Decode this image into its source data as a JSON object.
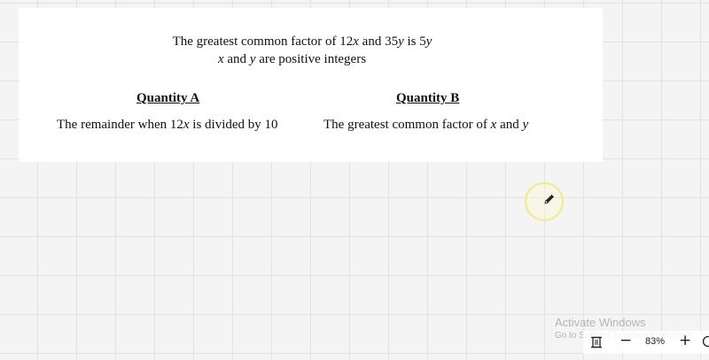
{
  "problem": {
    "statement_line1": {
      "p1": "The greatest common factor of 12",
      "v1": "x",
      "p2": " and 35",
      "v2": "y",
      "p3": " is 5",
      "v3": "y"
    },
    "statement_line2": {
      "v1": "x",
      "p1": " and ",
      "v2": "y",
      "p2": " are positive integers"
    },
    "quantity_a": {
      "heading": "Quantity A",
      "p1": "The remainder when 12",
      "v1": "x",
      "p2": " is divided by 10"
    },
    "quantity_b": {
      "heading": "Quantity B",
      "p1": "The greatest common factor of ",
      "v1": "x",
      "p2": " and ",
      "v2": "y"
    }
  },
  "watermark": {
    "line1": "Activate Windows",
    "line2": "Go to Settings to activate Windows."
  },
  "toolbar": {
    "fit_icon": "fit-page-icon",
    "zoom_out_label": "−",
    "zoom_level": "83%",
    "zoom_in_label": "+",
    "more_icon": "more-icon"
  },
  "cursor": {
    "icon": "pen-icon",
    "highlight_color": "#f2e98a"
  }
}
